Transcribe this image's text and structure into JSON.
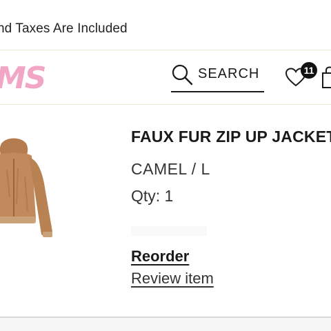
{
  "banner": {
    "text": "nd Taxes Are Included"
  },
  "header": {
    "logo_text": "MS",
    "search_label": "SEARCH",
    "wishlist_count": "11"
  },
  "order_item": {
    "title": "FAUX FUR ZIP UP JACKET",
    "variant": "CAMEL / L",
    "quantity": "Qty: 1",
    "reorder_label": "Reorder",
    "review_label": "Review item"
  },
  "colors": {
    "logo_pink": "#f0a6c4",
    "badge_black": "#111111",
    "jacket_camel": "#c28a5c"
  },
  "icons": {
    "search": "search-icon",
    "wishlist": "heart-icon",
    "bag": "bag-icon"
  }
}
